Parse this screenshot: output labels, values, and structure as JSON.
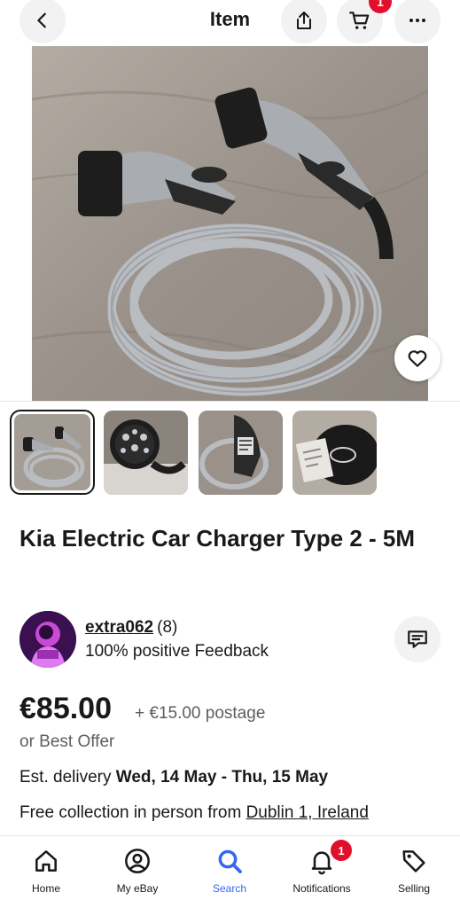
{
  "header": {
    "title": "Item",
    "cart_count": "1",
    "icons": [
      "back-arrow-icon",
      "share-icon",
      "cart-icon",
      "more-icon"
    ]
  },
  "gallery": {
    "main_image_alt": "Kia Electric Car Charger Type 2 cable",
    "thumbnail_count": 4,
    "selected_index": 0
  },
  "listing": {
    "title": "Kia Electric Car Charger Type 2 - 5M",
    "price": "€85.00",
    "postage": "+ €15.00 postage",
    "best_offer": "or Best Offer",
    "delivery_prefix": "Est. delivery ",
    "delivery_dates": "Wed, 14 May - Thu, 15 May",
    "collection_prefix": "Free collection in person from ",
    "collection_location": "Dublin 1, Ireland"
  },
  "seller": {
    "name": "extra062",
    "count": "(8)",
    "feedback": "100% positive Feedback"
  },
  "nav": {
    "items": [
      {
        "label": "Home",
        "icon": "home-icon"
      },
      {
        "label": "My eBay",
        "icon": "user-icon"
      },
      {
        "label": "Search",
        "icon": "search-icon"
      },
      {
        "label": "Notifications",
        "icon": "bell-icon"
      },
      {
        "label": "Selling",
        "icon": "tag-icon"
      }
    ],
    "active": "Search",
    "notifications_badge": "1"
  },
  "colors": {
    "accent": "#3665f3",
    "badge": "#e0102b",
    "text": "#191919",
    "muted": "#5e5e5e"
  }
}
